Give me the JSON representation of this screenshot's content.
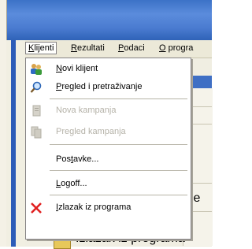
{
  "menubar": {
    "items": [
      {
        "prefix": "",
        "accel": "K",
        "rest": "lijenti"
      },
      {
        "prefix": "",
        "accel": "R",
        "rest": "ezultati"
      },
      {
        "prefix": "",
        "accel": "P",
        "rest": "odaci"
      },
      {
        "prefix": "",
        "accel": "O",
        "rest": " progra"
      }
    ]
  },
  "dropdown": {
    "items": [
      {
        "accel": "N",
        "rest": "ovi klijent",
        "enabled": true,
        "icon": "people-icon"
      },
      {
        "accel": "P",
        "rest": "regled i pretraživanje",
        "enabled": true,
        "icon": "magnifier-icon"
      },
      {
        "accel": "",
        "rest": "Nova kampanja",
        "enabled": false,
        "icon": "document-icon"
      },
      {
        "accel": "",
        "rest": "Pregled kampanja",
        "enabled": false,
        "icon": "documents-icon"
      },
      {
        "accel": "",
        "pre": "Pos",
        "mid": "t",
        "post": "avke...",
        "enabled": true,
        "icon": ""
      },
      {
        "accel": "L",
        "rest": "ogoff...",
        "enabled": true,
        "icon": ""
      },
      {
        "accel": "I",
        "rest": "zlazak iz programa",
        "enabled": true,
        "icon": "red-x-icon"
      }
    ]
  },
  "background": {
    "partial_right": "je",
    "partial_bottom": "Izlazak iz programa"
  },
  "colors": {
    "titlebar_blue": "#3c72c7",
    "menubar_bg": "#ece9d8",
    "disabled_text": "#b5b2a8",
    "exit_red": "#e02020"
  }
}
